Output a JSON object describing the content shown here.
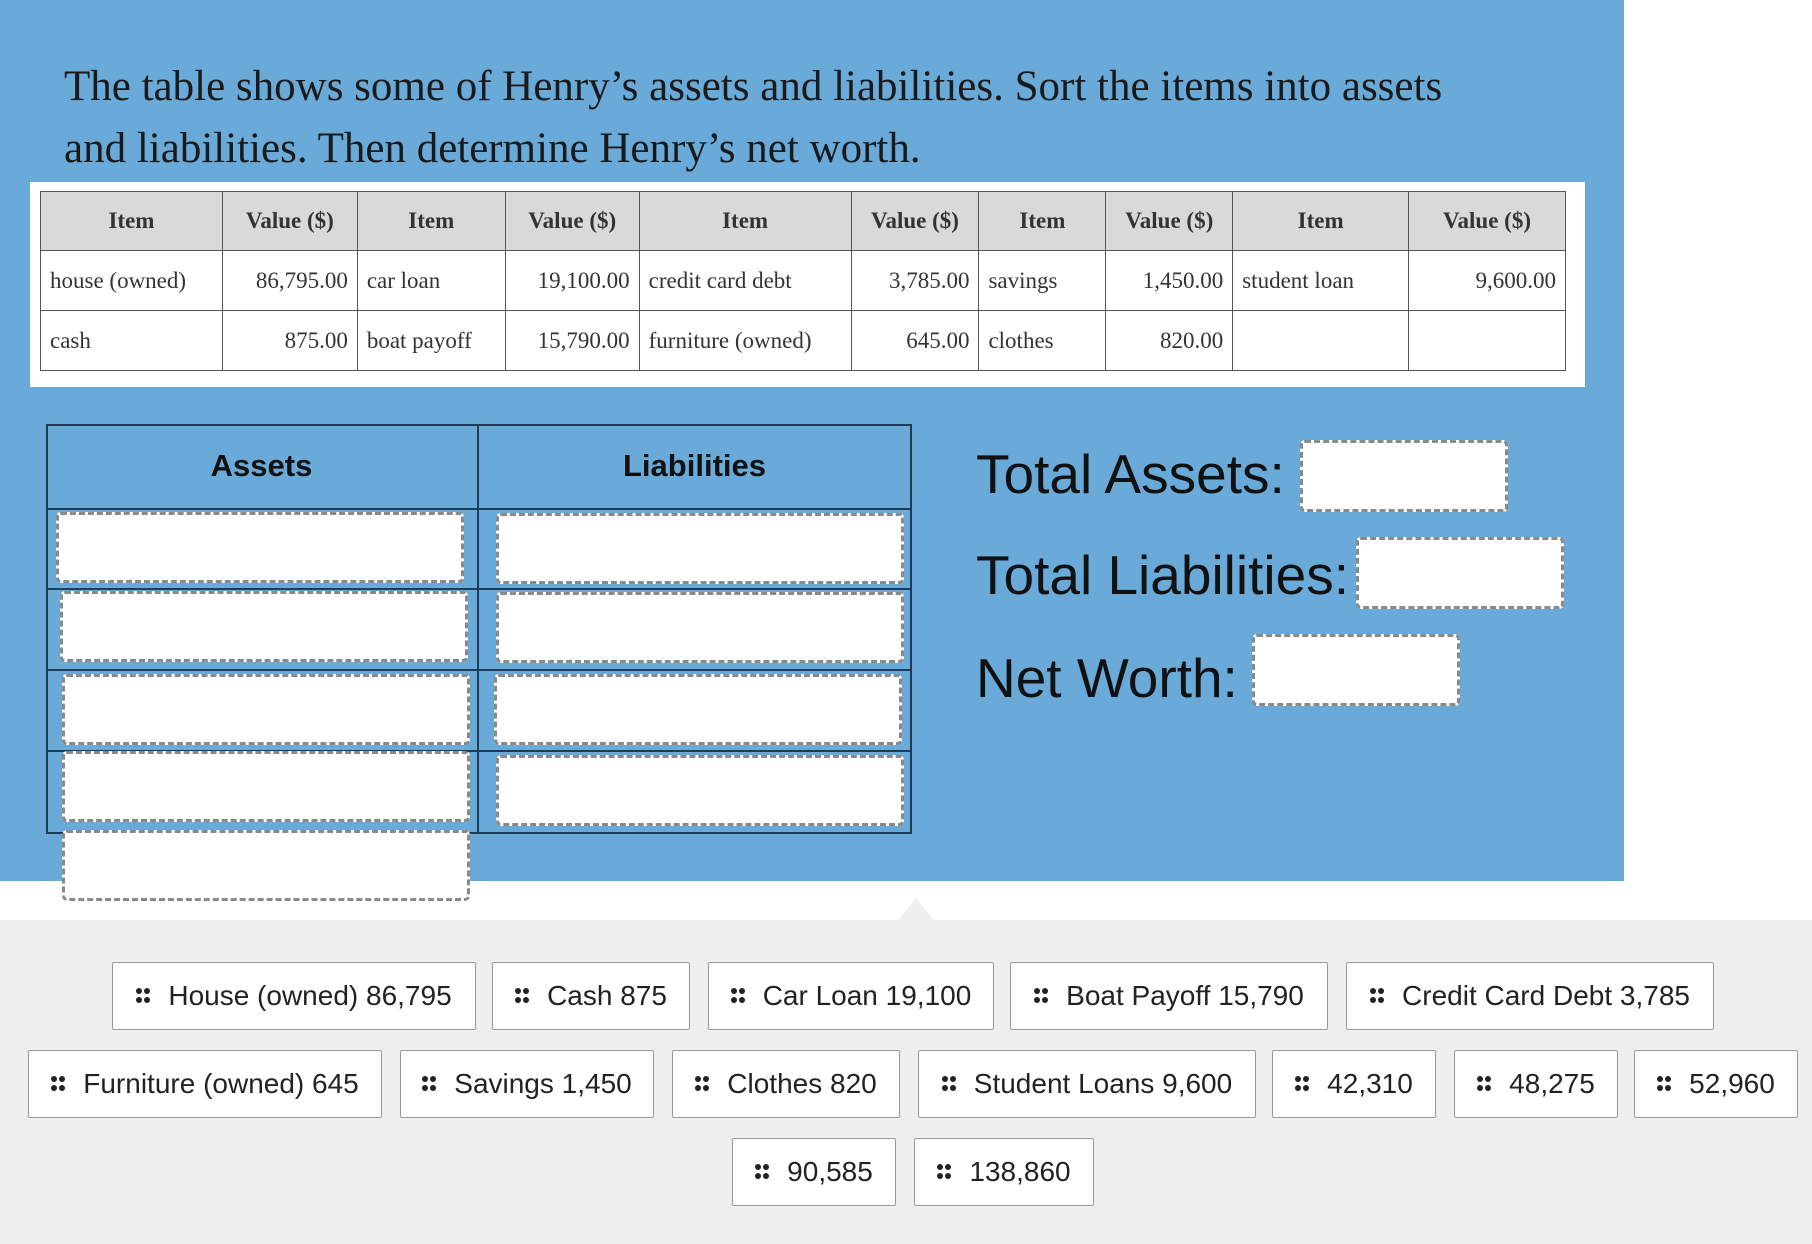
{
  "prompt": {
    "line1": "The table shows some of Henry’s assets and liabilities. Sort the items into assets",
    "line2": "and liabilities.  Then determine Henry’s net worth."
  },
  "data_table": {
    "headers": [
      "Item",
      "Value ($)",
      "Item",
      "Value ($)",
      "Item",
      "Value ($)",
      "Item",
      "Value ($)",
      "Item",
      "Value ($)"
    ],
    "rows": [
      [
        "house (owned)",
        "86,795.00",
        "car loan",
        "19,100.00",
        "credit card debt",
        "3,785.00",
        "savings",
        "1,450.00",
        "student loan",
        "9,600.00"
      ],
      [
        "cash",
        "875.00",
        "boat payoff",
        "15,790.00",
        "furniture (owned)",
        "645.00",
        "clothes",
        "820.00",
        "",
        ""
      ]
    ]
  },
  "sort_grid": {
    "assets_header": "Assets",
    "liabilities_header": "Liabilities"
  },
  "totals": {
    "total_assets_label": "Total Assets:",
    "total_liabilities_label": "Total Liabilities:",
    "net_worth_label": "Net Worth:"
  },
  "tray": {
    "icon": "drag-handle-icon",
    "chips": [
      "House (owned) 86,795",
      "Cash 875",
      "Car Loan 19,100",
      "Boat Payoff 15,790",
      "Credit Card Debt 3,785",
      "Furniture (owned) 645",
      "Savings 1,450",
      "Clothes 820",
      "Student Loans 9,600",
      "42,310",
      "48,275",
      "52,960",
      "90,585",
      "138,860"
    ]
  },
  "colors": {
    "panel": "#6aaad9",
    "tray": "#efefef",
    "grid_line": "#1e3b57",
    "table_header": "#d9d9d9"
  }
}
